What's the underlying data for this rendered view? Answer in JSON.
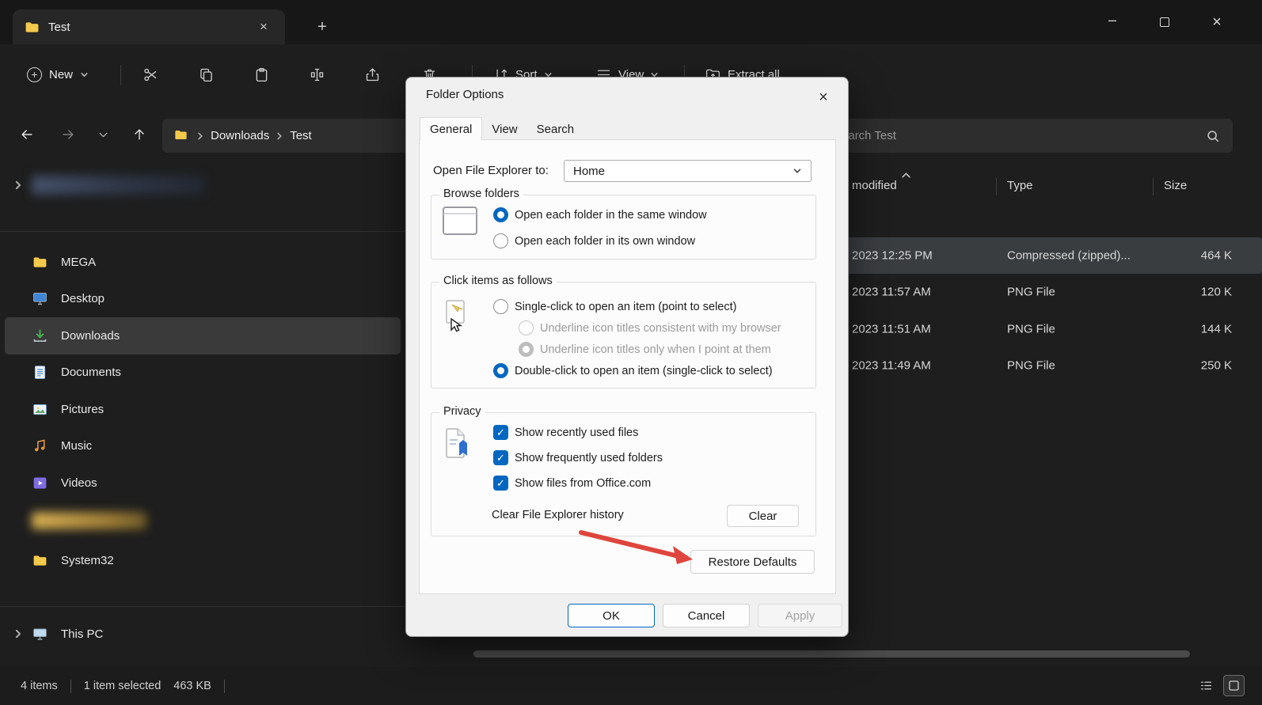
{
  "colors": {
    "accent_blue": "#0067c0",
    "arrow_red": "#de453d",
    "selection_gray": "#3a3d40"
  },
  "icons": {
    "close_glyph": "×",
    "check_glyph": "✓",
    "plus_glyph": "+",
    "minimize_glyph": "–"
  },
  "window": {
    "tab_title": "Test"
  },
  "toolbar": {
    "new_label": "New",
    "sort_label": "Sort",
    "view_label": "View",
    "extract_label": "Extract all"
  },
  "navbar": {
    "crumbs": [
      "Downloads",
      "Test"
    ],
    "search_value": "Search Test"
  },
  "sidebar": {
    "items": [
      {
        "label": "MEGA",
        "icon": "folder-icon"
      },
      {
        "label": "Desktop",
        "icon": "desktop-icon"
      },
      {
        "label": "Downloads",
        "icon": "downloads-icon",
        "selected": true
      },
      {
        "label": "Documents",
        "icon": "documents-icon"
      },
      {
        "label": "Pictures",
        "icon": "pictures-icon"
      },
      {
        "label": "Music",
        "icon": "music-icon"
      },
      {
        "label": "Videos",
        "icon": "videos-icon"
      },
      {
        "label": "System32",
        "icon": "folder-icon"
      },
      {
        "label": "This PC",
        "icon": "this-pc-icon"
      }
    ]
  },
  "file_list": {
    "columns": {
      "modified": "modified",
      "type": "Type",
      "size": "Size"
    },
    "rows": [
      {
        "modified": "2023 12:25 PM",
        "type": "Compressed (zipped)...",
        "size": "464 K",
        "selected": true
      },
      {
        "modified": "2023 11:57 AM",
        "type": "PNG File",
        "size": "120 K",
        "selected": false
      },
      {
        "modified": "2023 11:51 AM",
        "type": "PNG File",
        "size": "144 K",
        "selected": false
      },
      {
        "modified": "2023 11:49 AM",
        "type": "PNG File",
        "size": "250 K",
        "selected": false
      }
    ]
  },
  "status_bar": {
    "items_count": "4 items",
    "selection": "1 item selected",
    "selection_size": "463 KB"
  },
  "dialog": {
    "title": "Folder Options",
    "tabs": [
      {
        "label": "General",
        "active": true
      },
      {
        "label": "View",
        "active": false
      },
      {
        "label": "Search",
        "active": false
      }
    ],
    "open_to": {
      "label": "Open File Explorer to:",
      "value": "Home"
    },
    "browse_folders": {
      "caption": "Browse folders",
      "options": [
        {
          "label": "Open each folder in the same window",
          "selected": true
        },
        {
          "label": "Open each folder in its own window",
          "selected": false
        }
      ]
    },
    "click_items": {
      "caption": "Click items as follows",
      "options": [
        {
          "label": "Single-click to open an item (point to select)",
          "selected": false,
          "disabled": false
        },
        {
          "label": "Underline icon titles consistent with my browser",
          "selected": false,
          "disabled": true
        },
        {
          "label": "Underline icon titles only when I point at them",
          "selected": true,
          "disabled": true
        },
        {
          "label": "Double-click to open an item (single-click to select)",
          "selected": true,
          "disabled": false
        }
      ]
    },
    "privacy": {
      "caption": "Privacy",
      "checkboxes": [
        {
          "label": "Show recently used files",
          "checked": true
        },
        {
          "label": "Show frequently used folders",
          "checked": true
        },
        {
          "label": "Show files from Office.com",
          "checked": true
        }
      ],
      "clear_history_label": "Clear File Explorer history",
      "clear_button": "Clear"
    },
    "restore_defaults_label": "Restore Defaults",
    "buttons": {
      "ok": "OK",
      "cancel": "Cancel",
      "apply": "Apply"
    }
  }
}
